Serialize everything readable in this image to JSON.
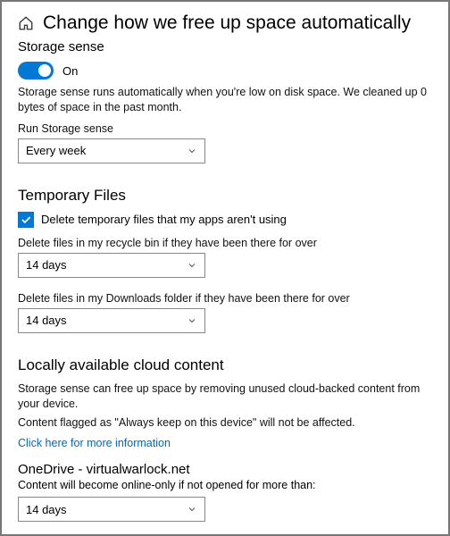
{
  "header": {
    "title": "Change how we free up space automatically"
  },
  "storage_sense": {
    "heading": "Storage sense",
    "toggle_state": "On",
    "description": "Storage sense runs automatically when you're low on disk space. We cleaned up 0 bytes of space in the past month.",
    "run_label": "Run Storage sense",
    "run_value": "Every week"
  },
  "temporary_files": {
    "heading": "Temporary Files",
    "checkbox_label": "Delete temporary files that my apps aren't using",
    "recycle_label": "Delete files in my recycle bin if they have been there for over",
    "recycle_value": "14 days",
    "downloads_label": "Delete files in my Downloads folder if they have been there for over",
    "downloads_value": "14 days"
  },
  "cloud_content": {
    "heading": "Locally available cloud content",
    "line1": "Storage sense can free up space by removing unused cloud-backed content from your device.",
    "line2": "Content flagged as \"Always keep on this device\" will not be affected.",
    "link_text": "Click here for more information",
    "onedrive_title": "OneDrive - virtualwarlock.net",
    "onedrive_desc": "Content will become online-only if not opened for more than:",
    "onedrive_value": "14 days"
  }
}
